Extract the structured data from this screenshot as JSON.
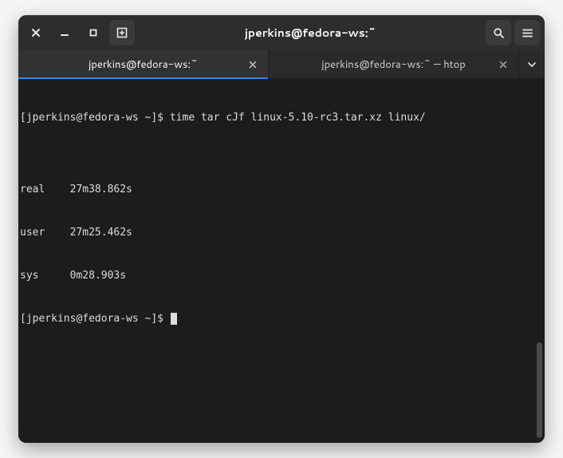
{
  "window": {
    "title": "jperkins@fedora-ws:~"
  },
  "tabs": [
    {
      "label": "jperkins@fedora-ws:~",
      "active": true
    },
    {
      "label": "jperkins@fedora-ws:~ — htop",
      "active": false
    }
  ],
  "terminal": {
    "prompt": "[jperkins@fedora-ws ~]$ ",
    "command": "time tar cJf linux-5.10-rc3.tar.xz linux/",
    "output": [
      "",
      "real    27m38.862s",
      "user    27m25.462s",
      "sys     0m28.903s"
    ],
    "prompt2": "[jperkins@fedora-ws ~]$ "
  }
}
